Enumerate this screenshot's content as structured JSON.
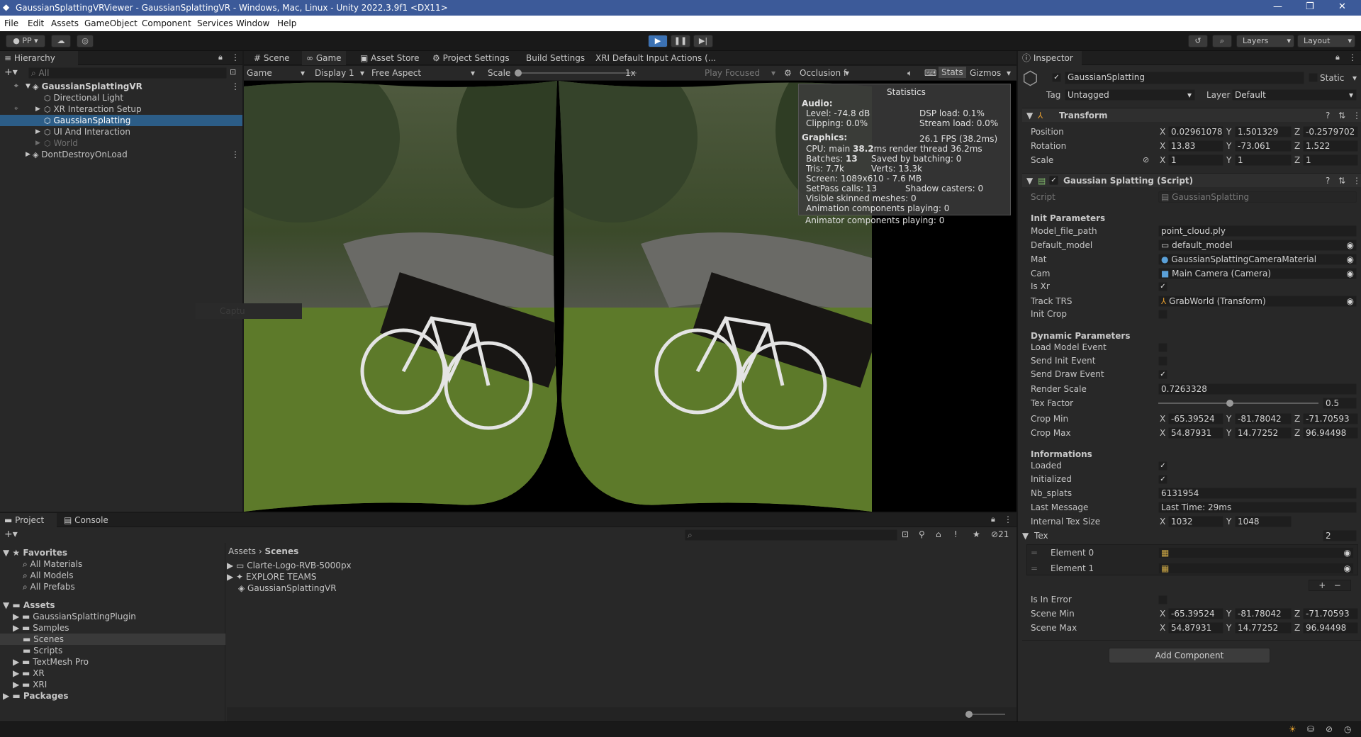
{
  "window": {
    "title": "GaussianSplattingVRViewer - GaussianSplattingVR - Windows, Mac, Linux - Unity 2022.3.9f1 <DX11>"
  },
  "menu": [
    "File",
    "Edit",
    "Assets",
    "GameObject",
    "Component",
    "Services",
    "Window",
    "Help"
  ],
  "toolbar": {
    "account": "PP",
    "layers": "Layers",
    "layout": "Layout"
  },
  "hierarchy": {
    "tab": "Hierarchy",
    "search_placeholder": "All",
    "items": [
      {
        "label": "GaussianSplattingVR"
      },
      {
        "label": "Directional Light"
      },
      {
        "label": "XR Interaction Setup"
      },
      {
        "label": "GaussianSplatting"
      },
      {
        "label": "UI And Interaction"
      },
      {
        "label": "World"
      },
      {
        "label": "DontDestroyOnLoad"
      }
    ]
  },
  "center_tabs": [
    "Scene",
    "Game",
    "Asset Store",
    "Project Settings",
    "Build Settings",
    "XRI Default Input Actions (..."
  ],
  "game_bar": {
    "mode": "Game",
    "display": "Display 1",
    "aspect": "Free Aspect",
    "scale_label": "Scale",
    "scale_value": "1x",
    "play_focused": "Play Focused",
    "occlusion": "Occlusion f",
    "stats": "Stats",
    "gizmos": "Gizmos"
  },
  "statistics": {
    "title": "Statistics",
    "audio_header": "Audio:",
    "level": "Level: -74.8 dB",
    "clipping": "Clipping: 0.0%",
    "dsp": "DSP load: 0.1%",
    "stream": "Stream load: 0.0%",
    "graphics_header": "Graphics:",
    "fps": "26.1 FPS (38.2ms)",
    "cpu_prefix": "CPU: main ",
    "cpu_main": "38.2",
    "cpu_suffix": "ms  render thread 36.2ms",
    "batches_prefix": "Batches: ",
    "batches": "13",
    "saved": "Saved by batching: 0",
    "tris": "Tris: 7.7k",
    "verts": "Verts: 13.3k",
    "screen": "Screen: 1089x610 - 7.6 MB",
    "setpass": "SetPass calls: 13",
    "shadow": "Shadow casters: 0",
    "skinned": "Visible skinned meshes: 0",
    "anim": "Animation components playing: 0",
    "animator": "Animator components playing: 0"
  },
  "capture_ghost": "Captu",
  "bottom_tabs": [
    "Project",
    "Console"
  ],
  "project": {
    "count": "21",
    "favorites_label": "Favorites",
    "favorites": [
      "All Materials",
      "All Models",
      "All Prefabs"
    ],
    "assets_label": "Assets",
    "assets": [
      "GaussianSplattingPlugin",
      "Samples",
      "Scenes",
      "Scripts",
      "TextMesh Pro",
      "XR",
      "XRI"
    ],
    "packages_label": "Packages",
    "breadcrumb": [
      "Assets",
      "Scenes"
    ],
    "files": [
      "Clarte-Logo-RVB-5000px",
      "EXPLORE TEAMS",
      "GaussianSplattingVR"
    ]
  },
  "inspector": {
    "tab": "Inspector",
    "object_name": "GaussianSplatting",
    "static_label": "Static",
    "tag_label": "Tag",
    "tag": "Untagged",
    "layer_label": "Layer",
    "layer": "Default",
    "transform": {
      "title": "Transform",
      "position_label": "Position",
      "position": [
        "0.02961078",
        "1.501329",
        "-0.2579702"
      ],
      "rotation_label": "Rotation",
      "rotation": [
        "13.83",
        "-73.061",
        "1.522"
      ],
      "scale_label": "Scale",
      "scale": [
        "1",
        "1",
        "1"
      ]
    },
    "script_comp": {
      "title": "Gaussian Splatting (Script)",
      "script_label": "Script",
      "script": "GaussianSplatting",
      "init_header": "Init Parameters",
      "model_file_path_label": "Model_file_path",
      "model_file_path": "point_cloud.ply",
      "default_model_label": "Default_model",
      "default_model": "default_model",
      "mat_label": "Mat",
      "mat": "GaussianSplattingCameraMaterial",
      "cam_label": "Cam",
      "cam": "Main Camera (Camera)",
      "is_xr_label": "Is Xr",
      "track_trs_label": "Track TRS",
      "track_trs": "GrabWorld (Transform)",
      "init_crop_label": "Init Crop",
      "dynamic_header": "Dynamic Parameters",
      "load_model_event_label": "Load Model Event",
      "send_init_event_label": "Send Init Event",
      "send_draw_event_label": "Send Draw Event",
      "render_scale_label": "Render Scale",
      "render_scale": "0.7263328",
      "tex_factor_label": "Tex Factor",
      "tex_factor": "0.5",
      "crop_min_label": "Crop Min",
      "crop_min": [
        "-65.39524",
        "-81.78042",
        "-71.70593"
      ],
      "crop_max_label": "Crop Max",
      "crop_max": [
        "54.87931",
        "14.77252",
        "96.94498"
      ],
      "info_header": "Informations",
      "loaded_label": "Loaded",
      "initialized_label": "Initialized",
      "nb_splats_label": "Nb_splats",
      "nb_splats": "6131954",
      "last_message_label": "Last Message",
      "last_message": "Last Time: 29ms",
      "internal_tex_label": "Internal Tex Size",
      "internal_tex": [
        "1032",
        "1048"
      ],
      "tex_label": "Tex",
      "tex_count": "2",
      "element0": "Element 0",
      "element1": "Element 1",
      "is_in_error_label": "Is In Error",
      "scene_min_label": "Scene Min",
      "scene_min": [
        "-65.39524",
        "-81.78042",
        "-71.70593"
      ],
      "scene_max_label": "Scene Max",
      "scene_max": [
        "54.87931",
        "14.77252",
        "96.94498"
      ]
    },
    "add_component": "Add Component"
  },
  "axes": {
    "x": "X",
    "y": "Y",
    "z": "Z"
  }
}
